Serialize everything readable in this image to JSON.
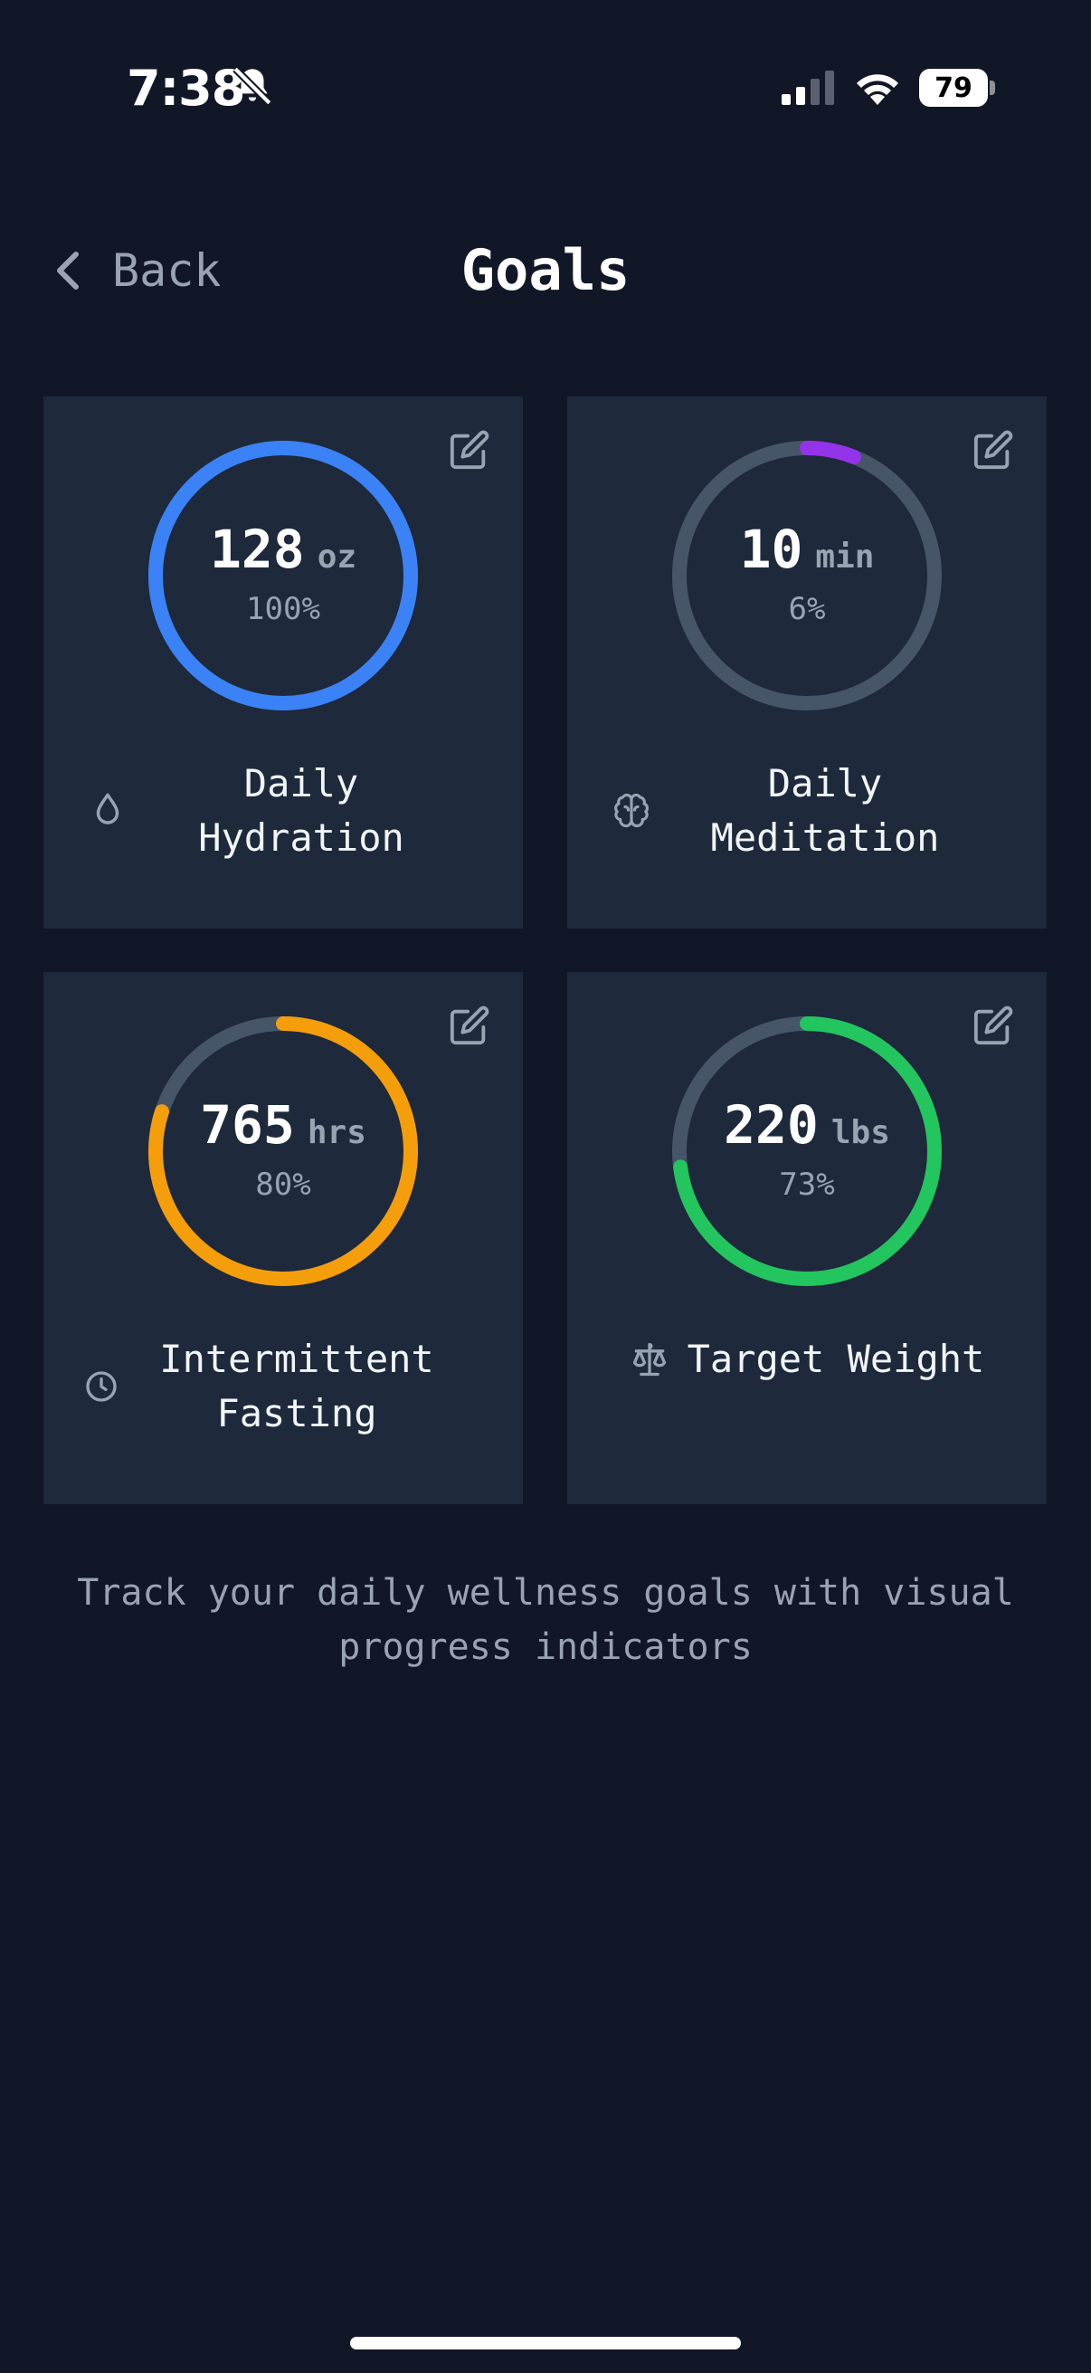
{
  "status_bar": {
    "time": "7:38",
    "battery": "79"
  },
  "header": {
    "back_label": "Back",
    "title": "Goals"
  },
  "goals": [
    {
      "value": "128",
      "unit": "oz",
      "percent_label": "100%",
      "progress": 1.0,
      "label": "Daily Hydration",
      "color": "#3b82f6",
      "icon": "droplet-icon"
    },
    {
      "value": "10",
      "unit": "min",
      "percent_label": "6%",
      "progress": 0.06,
      "label": "Daily Meditation",
      "color": "#9333ea",
      "icon": "brain-icon"
    },
    {
      "value": "765",
      "unit": "hrs",
      "percent_label": "80%",
      "progress": 0.8,
      "label": "Intermittent Fasting",
      "color": "#f59e0b",
      "icon": "clock-icon"
    },
    {
      "value": "220",
      "unit": "lbs",
      "percent_label": "73%",
      "progress": 0.73,
      "label": "Target Weight",
      "color": "#22c55e",
      "icon": "scale-icon"
    }
  ],
  "footer_text": "Track your daily wellness goals with visual progress indicators",
  "colors": {
    "background": "#111727",
    "card": "#1e293b",
    "ring_track": "#475569"
  }
}
